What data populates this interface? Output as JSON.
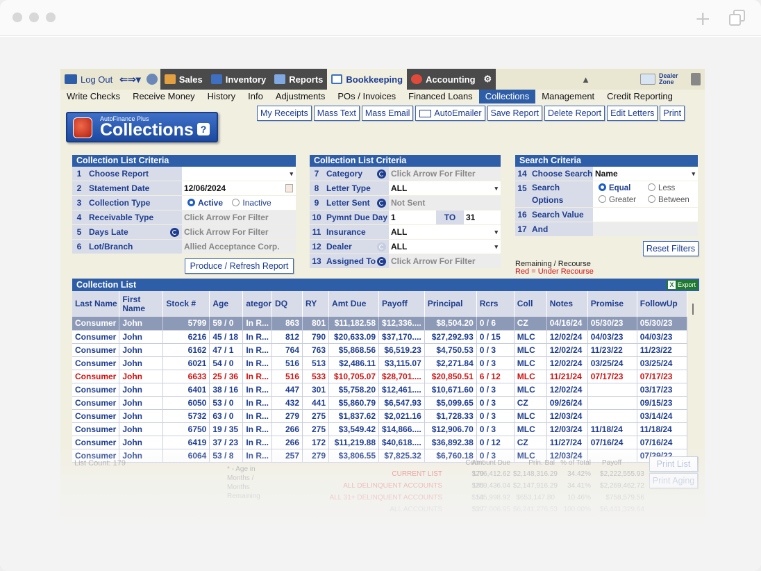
{
  "topnav": {
    "logout": "Log Out",
    "sales": "Sales",
    "inventory": "Inventory",
    "reports": "Reports",
    "bookkeeping": "Bookkeeping",
    "accounting": "Accounting",
    "dealer_zone": "Dealer Zone"
  },
  "subnav": [
    "Write Checks",
    "Receive Money",
    "History",
    "Info",
    "Adjustments",
    "POs / Invoices",
    "Financed Loans",
    "Collections",
    "Management",
    "Credit Reporting"
  ],
  "logo": {
    "sub": "AutoFinance Plus",
    "title": "Collections",
    "help": "?"
  },
  "toolbar": [
    "My Receipts",
    "Mass Text",
    "Mass Email",
    "AutoEmailer",
    "Save Report",
    "Delete Report",
    "Edit Letters",
    "Print"
  ],
  "criteria1": {
    "title": "Collection List Criteria",
    "rows": [
      {
        "n": "1",
        "label": "Choose Report",
        "value": ""
      },
      {
        "n": "2",
        "label": "Statement Date",
        "value": "12/06/2024"
      },
      {
        "n": "3",
        "label": "Collection Type",
        "opt1": "Active",
        "opt2": "Inactive"
      },
      {
        "n": "4",
        "label": "Receivable Type",
        "value": "Click Arrow For Filter"
      },
      {
        "n": "5",
        "label": "Days Late",
        "value": "Click Arrow For Filter"
      },
      {
        "n": "6",
        "label": "Lot/Branch",
        "value": "Allied Acceptance Corp."
      }
    ],
    "button": "Produce / Refresh Report"
  },
  "criteria2": {
    "title": "Collection List Criteria",
    "rows": [
      {
        "n": "7",
        "label": "Category",
        "value": "Click Arrow For Filter"
      },
      {
        "n": "8",
        "label": "Letter Type",
        "value": "ALL"
      },
      {
        "n": "9",
        "label": "Letter Sent",
        "value": "Not Sent"
      },
      {
        "n": "10",
        "label": "Pymnt Due Day",
        "value": "1",
        "to": "TO",
        "value2": "31"
      },
      {
        "n": "11",
        "label": "Insurance",
        "value": "ALL"
      },
      {
        "n": "12",
        "label": "Dealer",
        "value": "ALL"
      },
      {
        "n": "13",
        "label": "Assigned To",
        "value": "Click Arrow For Filter"
      }
    ]
  },
  "search": {
    "title": "Search Criteria",
    "rows": [
      {
        "n": "14",
        "label": "Choose Search",
        "value": "Name"
      },
      {
        "n": "15",
        "label": "Search Options",
        "opts": [
          "Equal",
          "Less",
          "Greater",
          "Between"
        ]
      },
      {
        "n": "16",
        "label": "Search Value",
        "value": ""
      },
      {
        "n": "17",
        "label": "And",
        "value": ""
      }
    ],
    "reset": "Reset Filters",
    "legend1": "Remaining / Recourse",
    "legend2": "Red = Under Recourse"
  },
  "list": {
    "title": "Collection List",
    "export": "Export",
    "columns": [
      "Last Name",
      "First Name",
      "Stock #",
      "Age",
      "ategor",
      "DQ",
      "RY",
      "Amt Due",
      "Payoff",
      "Principal",
      "Rcrs",
      "Coll",
      "Notes",
      "Promise",
      "FollowUp"
    ],
    "rows": [
      [
        "Consumer",
        "John",
        "5799",
        "59 / 0",
        "In R...",
        "863",
        "801",
        "$11,182.58",
        "$12,336....",
        "$8,504.20",
        "0 / 6",
        "CZ",
        "04/16/24",
        "05/30/23",
        "05/30/23"
      ],
      [
        "Consumer",
        "John",
        "6216",
        "45 / 18",
        "In R...",
        "812",
        "790",
        "$20,633.09",
        "$37,170....",
        "$27,292.93",
        "0 / 15",
        "MLC",
        "12/02/24",
        "04/03/23",
        "04/03/23"
      ],
      [
        "Consumer",
        "John",
        "6162",
        "47 / 1",
        "In R...",
        "764",
        "763",
        "$5,868.56",
        "$6,519.23",
        "$4,750.53",
        "0 / 3",
        "MLC",
        "12/02/24",
        "11/23/22",
        "11/23/22"
      ],
      [
        "Consumer",
        "John",
        "6021",
        "54 / 0",
        "In R...",
        "516",
        "513",
        "$2,486.11",
        "$3,115.07",
        "$2,271.84",
        "0 / 3",
        "MLC",
        "12/02/24",
        "03/25/24",
        "03/25/24"
      ],
      [
        "Consumer",
        "John",
        "6633",
        "25 / 36",
        "In R...",
        "516",
        "533",
        "$10,705.07",
        "$28,701....",
        "$20,850.51",
        "6 / 12",
        "MLC",
        "11/21/24",
        "07/17/23",
        "07/17/23"
      ],
      [
        "Consumer",
        "John",
        "6401",
        "38 / 16",
        "In R...",
        "447",
        "301",
        "$5,758.20",
        "$12,461....",
        "$10,671.60",
        "0 / 3",
        "MLC",
        "12/02/24",
        "",
        "03/17/23"
      ],
      [
        "Consumer",
        "John",
        "6050",
        "53 / 0",
        "In R...",
        "432",
        "441",
        "$5,860.79",
        "$6,547.93",
        "$5,099.65",
        "0 / 3",
        "CZ",
        "09/26/24",
        "",
        "09/15/23"
      ],
      [
        "Consumer",
        "John",
        "5732",
        "63 / 0",
        "In R...",
        "279",
        "275",
        "$1,837.62",
        "$2,021.16",
        "$1,728.33",
        "0 / 3",
        "MLC",
        "12/03/24",
        "",
        "03/14/24"
      ],
      [
        "Consumer",
        "John",
        "6750",
        "19 / 35",
        "In R...",
        "266",
        "275",
        "$3,549.42",
        "$14,866....",
        "$12,906.70",
        "0 / 3",
        "MLC",
        "12/03/24",
        "11/18/24",
        "11/18/24"
      ],
      [
        "Consumer",
        "John",
        "6419",
        "37 / 23",
        "In R...",
        "266",
        "172",
        "$11,219.88",
        "$40,618....",
        "$36,892.38",
        "0 / 12",
        "CZ",
        "11/27/24",
        "07/16/24",
        "07/16/24"
      ],
      [
        "Consumer",
        "John",
        "6064",
        "53 / 8",
        "In R...",
        "257",
        "279",
        "$3,806.55",
        "$7,825.32",
        "$6,760.18",
        "0 / 3",
        "MLC",
        "12/03/24",
        "",
        "07/29/22"
      ]
    ]
  },
  "summary": {
    "list_count": "List Count:  179",
    "age_note": [
      "* - Age in",
      "Months /",
      "Months",
      "Remaining"
    ],
    "headers": [
      "Count",
      "Amount Due",
      "Prin. Bal",
      "% of Total",
      "Payoff"
    ],
    "lines": [
      {
        "label": "CURRENT LIST",
        "count": "179",
        "amt": "$206,412.62",
        "prin": "$2,148,316.29",
        "pct": "34.42%",
        "payoff": "$2,222,555.93"
      },
      {
        "label": "ALL DELINQUENT ACCOUNTS",
        "count": "185",
        "amt": "$209,436.04",
        "prin": "$2,147,916.29",
        "pct": "34.41%",
        "payoff": "$2,269,462.72"
      },
      {
        "label": "ALL 31+ DELINQUENT ACCOUNTS",
        "count": "58",
        "amt": "$145,998.92",
        "prin": "$653,147.80",
        "pct": "10.46%",
        "payoff": "$758,579.56"
      },
      {
        "label": "ALL ACCOUNTS",
        "count": "527",
        "amt": "$307,006.95",
        "prin": "$6,241,276.53",
        "pct": "100.00%",
        "payoff": "$6,441,329.64"
      }
    ],
    "print_list": "Print List",
    "print_aging": "Print Aging"
  }
}
